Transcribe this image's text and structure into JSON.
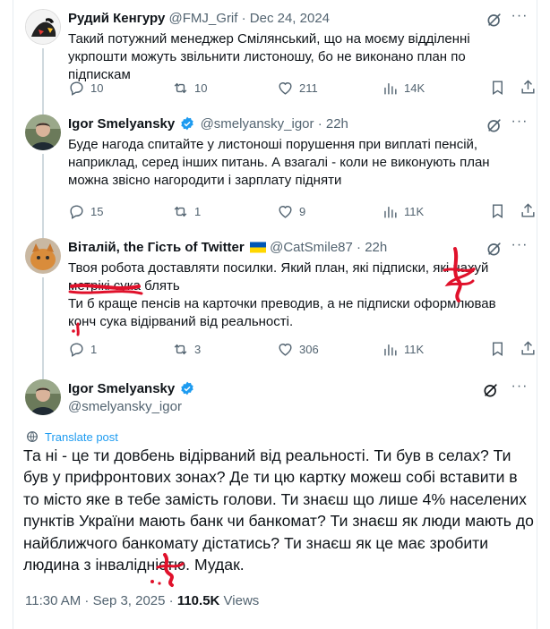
{
  "tweets": [
    {
      "name": "Рудий Кенгуру",
      "handle": "@FMJ_Grif",
      "time": "Dec 24, 2024",
      "body": "Такий потужний менеджер Смілянський, що на моєму відділенні укрпошти можуть звільнити листоношу, бо не виконано план по підпискам",
      "replies": "10",
      "reposts": "10",
      "likes": "211",
      "views": "14K"
    },
    {
      "name": "Igor Smelyansky",
      "handle": "@smelyansky_igor",
      "time": "22h",
      "body": "Буде нагода спитайте у листоноші порушення при виплаті пенсій, наприклад, серед інших питань. А взагалі - коли не виконують план можна звісно нагородити і зарплату підняти",
      "replies": "15",
      "reposts": "1",
      "likes": "9",
      "views": "11K"
    },
    {
      "name": "Віталій, the Гість of Twitter",
      "handle": "@CatSmile87",
      "time": "22h",
      "body_p1": "Твоя робота доставляти посилки. Який план, які підписки, які нахуй метрікі сука блять",
      "body_p2": "Ти б краще пенсів на карточки преводив, а не підписки оформлював конч сука відірваний від реальності.",
      "replies": "1",
      "reposts": "3",
      "likes": "306",
      "views": "11K"
    }
  ],
  "main": {
    "name": "Igor Smelyansky",
    "handle": "@smelyansky_igor",
    "translate": "Translate post",
    "body": "Та ні - це ти довбень відірваний від реальності. Ти був в селах? Ти був у прифронтових зонах? Де ти цю картку можеш собі вставити в то місто яке в тебе замість голови. Ти знаєш що лише 4% населених пунктів України мають банк чи банкомат? Ти знаєш як люди мають до найближчого банкомату дістатись? Ти знаєш як це має зробити людина з інвалідністю. Мудак.",
    "time": "11:30 AM · Sep 3, 2025 · ",
    "views_count": "110.5K",
    "views_label": " Views"
  },
  "colors": {
    "accent": "#1d9bf0",
    "muted": "#536471",
    "scribble": "#e0112b"
  }
}
